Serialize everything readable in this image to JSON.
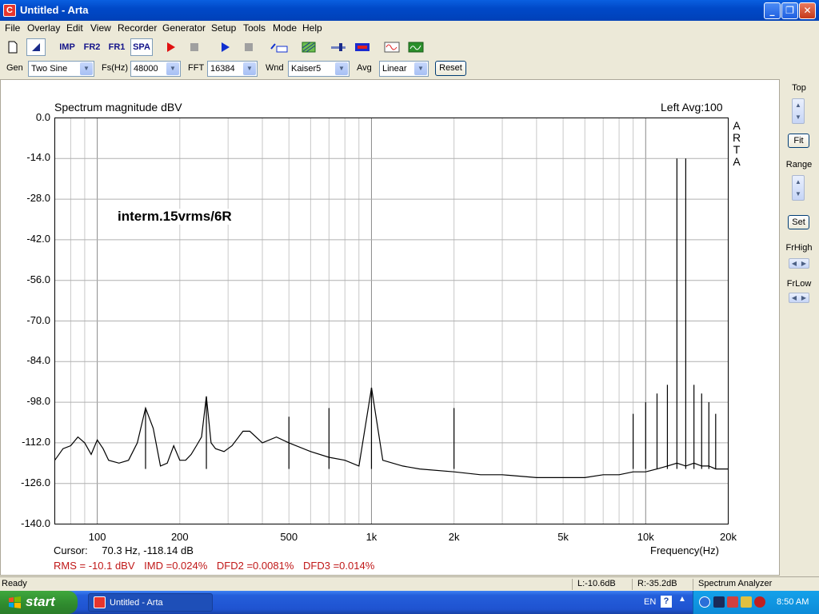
{
  "window": {
    "title": "Untitled - Arta",
    "app_icon_letter": "C",
    "minimize": "_",
    "maximize": "❐",
    "close": "✕"
  },
  "menu": [
    "File",
    "Overlay",
    "Edit",
    "View",
    "Recorder",
    "Generator",
    "Setup",
    "Tools",
    "Mode",
    "Help"
  ],
  "toolbar": {
    "imp": "IMP",
    "fr2": "FR2",
    "fr1": "FR1",
    "spa": "SPA",
    "icons": [
      "new-file-icon",
      "cursor-icon",
      "impulse-mode-icon",
      "fr2-mode-icon",
      "fr1-mode-icon",
      "spectrum-mode-icon",
      "record-icon",
      "stop-record-icon",
      "play-icon",
      "stop-icon",
      "abc-icon",
      "hatch-icon",
      "slider-icon",
      "color-bar-icon",
      "sine-icon",
      "scope-icon"
    ]
  },
  "params": {
    "gen_label": "Gen",
    "gen_value": "Two Sine",
    "fs_label": "Fs(Hz)",
    "fs_value": "48000",
    "fft_label": "FFT",
    "fft_value": "16384",
    "wnd_label": "Wnd",
    "wnd_value": "Kaiser5",
    "avg_label": "Avg",
    "avg_value": "Linear",
    "reset_label": "Reset"
  },
  "plot": {
    "title": "Spectrum magnitude dBV",
    "channel_info": "Left  Avg:100",
    "logo": [
      "A",
      "R",
      "T",
      "A"
    ],
    "annotation": "interm.15vrms/6R",
    "cursor_label": "Cursor:",
    "cursor_value": "70.3 Hz, -118.14 dB",
    "xlabel": "Frequency(Hz)",
    "measurements": {
      "rms": "RMS =  -10.1 dBV",
      "imd": "IMD =0.024%",
      "dfd2": "DFD2 =0.0081%",
      "dfd3": "DFD3 =0.014%"
    }
  },
  "chart_data": {
    "type": "line",
    "title": "Spectrum magnitude dBV",
    "xlabel": "Frequency(Hz)",
    "ylabel": "",
    "x_scale": "log",
    "xlim": [
      70,
      20000
    ],
    "ylim": [
      -140,
      0
    ],
    "grid": true,
    "y_ticks": [
      "0.0",
      "-14.0",
      "-28.0",
      "-42.0",
      "-56.0",
      "-70.0",
      "-84.0",
      "-98.0",
      "-112.0",
      "-126.0",
      "-140.0"
    ],
    "y_tick_values": [
      0,
      -14,
      -28,
      -42,
      -56,
      -70,
      -84,
      -98,
      -112,
      -126,
      -140
    ],
    "x_ticks": [
      "100",
      "200",
      "500",
      "1k",
      "2k",
      "5k",
      "10k",
      "20k"
    ],
    "x_tick_values": [
      100,
      200,
      500,
      1000,
      2000,
      5000,
      10000,
      20000
    ],
    "series": [
      {
        "values_note_excluded": false,
        "x": [
          70,
          75,
          80,
          85,
          90,
          95,
          100,
          105,
          110,
          120,
          130,
          140,
          150,
          160,
          170,
          180,
          190,
          200,
          210,
          220,
          230,
          240,
          250,
          260,
          270,
          290,
          310,
          340,
          360,
          400,
          450,
          500,
          600,
          700,
          800,
          900,
          1000,
          1100,
          1300,
          1500,
          2000,
          2500,
          3000,
          4000,
          5000,
          6000,
          7000,
          8000,
          9000,
          10000,
          11000,
          12000,
          13000,
          14000,
          15000,
          16000,
          17000,
          18000,
          19000,
          20000
        ],
        "y": [
          -118,
          -114,
          -113,
          -110,
          -112,
          -116,
          -111,
          -114,
          -118,
          -119,
          -118,
          -112,
          -100,
          -107,
          -120,
          -119,
          -113,
          -118,
          -118,
          -116,
          -113,
          -110,
          -96,
          -112,
          -114,
          -115,
          -113,
          -108,
          -108,
          -112,
          -110,
          -112,
          -115,
          -117,
          -118,
          -120,
          -93,
          -118,
          -120,
          -121,
          -122,
          -123,
          -123,
          -124,
          -124,
          -124,
          -123,
          -123,
          -122,
          -122,
          -121,
          -120,
          -119,
          -120,
          -119,
          -120,
          -120,
          -121,
          -121,
          -121
        ]
      }
    ],
    "peaks": [
      {
        "x": 13000,
        "y": -14
      },
      {
        "x": 14000,
        "y": -14
      },
      {
        "x": 12000,
        "y": -92
      },
      {
        "x": 15000,
        "y": -92
      },
      {
        "x": 11000,
        "y": -95
      },
      {
        "x": 16000,
        "y": -95
      },
      {
        "x": 10000,
        "y": -98
      },
      {
        "x": 17000,
        "y": -98
      },
      {
        "x": 9000,
        "y": -102
      },
      {
        "x": 18000,
        "y": -102
      },
      {
        "x": 1000,
        "y": -93
      },
      {
        "x": 250,
        "y": -96
      },
      {
        "x": 150,
        "y": -100
      },
      {
        "x": 700,
        "y": -100
      },
      {
        "x": 2000,
        "y": -100
      },
      {
        "x": 500,
        "y": -103
      }
    ]
  },
  "side": {
    "top_label": "Top",
    "fit_label": "Fit",
    "range_label": "Range",
    "set_label": "Set",
    "frhigh_label": "FrHigh",
    "frlow_label": "FrLow"
  },
  "status": {
    "ready": "Ready",
    "left_level": "L:-10.6dB",
    "right_level": "R:-35.2dB",
    "mode": "Spectrum Analyzer"
  },
  "taskbar": {
    "start": "start",
    "task": "Untitled - Arta",
    "lang": "EN",
    "help": "?",
    "clock": "8:50 AM"
  }
}
